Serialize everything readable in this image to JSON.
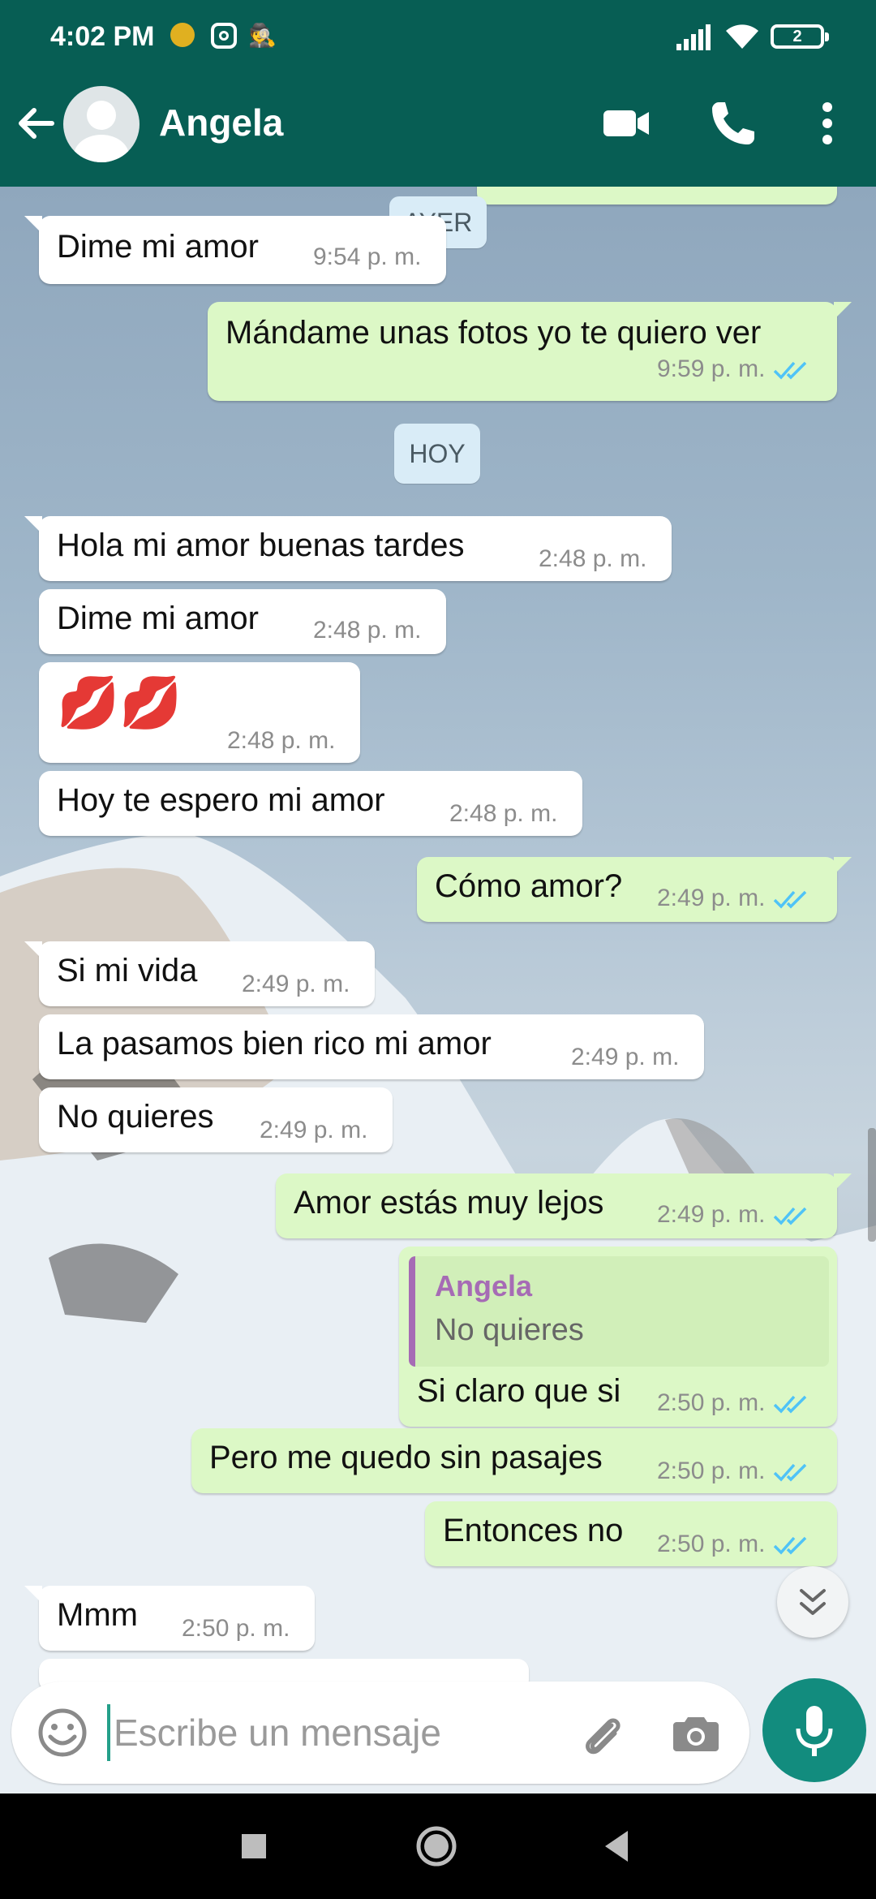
{
  "status_bar": {
    "time": "4:02 PM",
    "battery": "2"
  },
  "header": {
    "contact_name": "Angela"
  },
  "date_chips": {
    "yesterday": "AYER",
    "today": "HOY"
  },
  "messages": [
    {
      "dir": "in",
      "text": "Dime mi amor",
      "time": "9:54 p. m."
    },
    {
      "dir": "out",
      "text": "Mándame unas fotos yo te quiero ver",
      "time": "9:59 p. m."
    },
    {
      "dir": "in",
      "text": "Hola mi amor buenas tardes",
      "time": "2:48 p. m."
    },
    {
      "dir": "in",
      "text": "Dime mi amor",
      "time": "2:48 p. m."
    },
    {
      "dir": "in",
      "text": "💋💋",
      "time": "2:48 p. m."
    },
    {
      "dir": "in",
      "text": "Hoy te espero mi amor",
      "time": "2:48 p. m."
    },
    {
      "dir": "out",
      "text": "Cómo amor?",
      "time": "2:49 p. m."
    },
    {
      "dir": "in",
      "text": "Si mi vida",
      "time": "2:49 p. m."
    },
    {
      "dir": "in",
      "text": "La pasamos bien rico mi amor",
      "time": "2:49 p. m."
    },
    {
      "dir": "in",
      "text": "No quieres",
      "time": "2:49 p. m."
    },
    {
      "dir": "out",
      "text": "Amor estás muy lejos",
      "time": "2:49 p. m."
    },
    {
      "dir": "out",
      "text": "Si claro que si",
      "time": "2:50 p. m.",
      "quote": {
        "name": "Angela",
        "text": "No quieres"
      }
    },
    {
      "dir": "out",
      "text": "Pero me quedo sin pasajes",
      "time": "2:50 p. m."
    },
    {
      "dir": "out",
      "text": "Entonces no",
      "time": "2:50 p. m."
    },
    {
      "dir": "in",
      "text": "Mmm",
      "time": "2:50 p. m."
    }
  ],
  "composer": {
    "placeholder": "Escribe un mensaje"
  },
  "colors": {
    "header": "#075e54",
    "outgoing_bubble": "#dcf8c6",
    "incoming_bubble": "#ffffff",
    "read_tick": "#4fc3f7",
    "mic_button": "#128c7e"
  },
  "icons": [
    "back-arrow-icon",
    "avatar-icon",
    "video-call-icon",
    "voice-call-icon",
    "more-options-icon",
    "emoji-icon",
    "attach-icon",
    "camera-icon",
    "mic-icon",
    "scroll-down-icon",
    "recents-icon",
    "home-icon",
    "back-nav-icon"
  ]
}
